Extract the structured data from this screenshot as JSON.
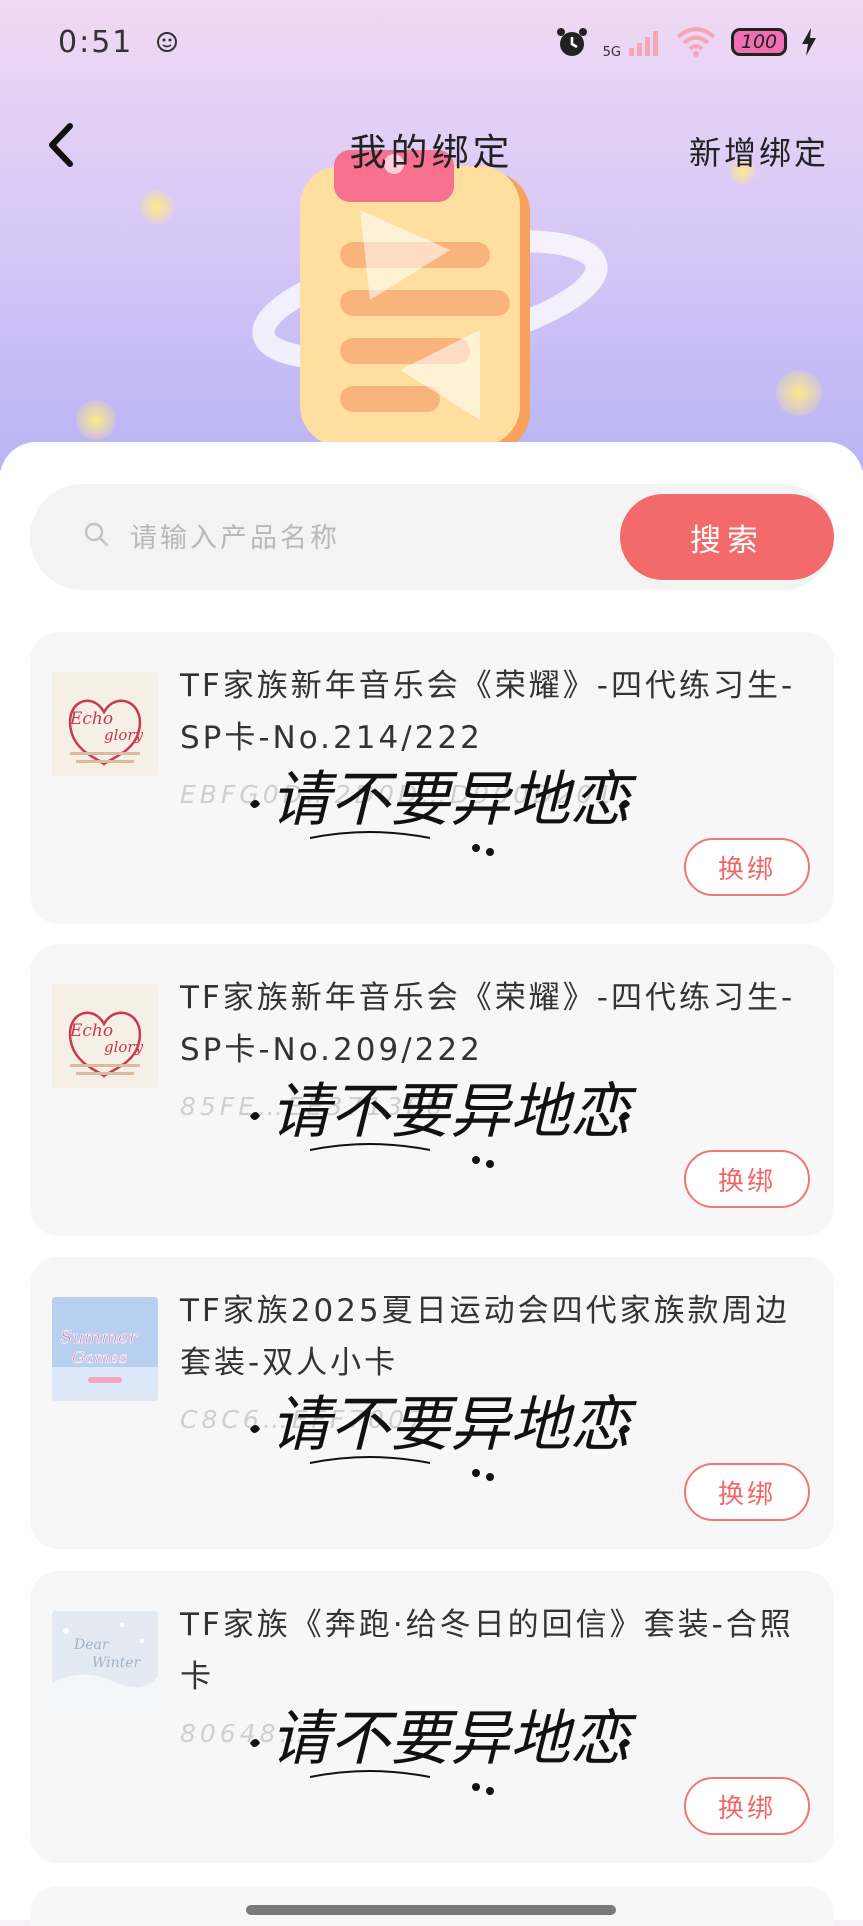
{
  "status_bar": {
    "time": "0:51",
    "network": "5G",
    "battery": "100"
  },
  "header": {
    "title": "我的绑定",
    "add_binding": "新增绑定"
  },
  "search": {
    "placeholder": "请输入产品名称",
    "button": "搜索"
  },
  "watermark_text": "请不要异地恋",
  "bindings": [
    {
      "title": "TF家族新年音乐会《荣耀》-四代练习生-SP卡-No.214/222",
      "code": "EBFG0D…2D0D…D900D201",
      "action": "换绑",
      "thumb_text": "Echo glory"
    },
    {
      "title": "TF家族新年音乐会《荣耀》-四代练习生-SP卡-No.209/222",
      "code": "85FE…EE3713E6",
      "action": "换绑",
      "thumb_text": "Echo glory"
    },
    {
      "title": "TF家族2025夏日运动会四代家族款周边套装-双人小卡",
      "code": "C8C6…EFF7007",
      "action": "换绑",
      "thumb_text": "Summer Games"
    },
    {
      "title": "TF家族《奔跑·给冬日的回信》套装-合照卡",
      "code": "80648…",
      "action": "换绑",
      "thumb_text": "Dear Winter"
    }
  ],
  "colors": {
    "accent": "#f36a6a",
    "hero_top": "#efd9f3",
    "hero_bottom": "#b9b4f5"
  }
}
